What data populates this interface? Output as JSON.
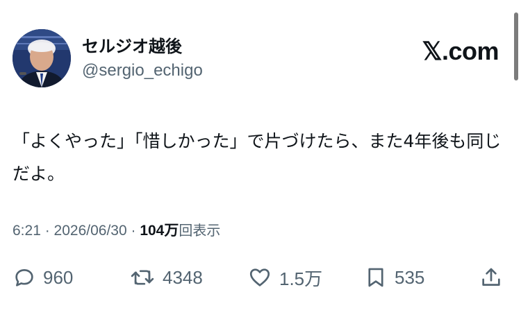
{
  "author": {
    "display_name": "セルジオ越後",
    "handle": "@sergio_echigo"
  },
  "brand": "𝕏.com",
  "tweet": {
    "text": "「よくやった」「惜しかった」で片づけたら、また4年後も同じだよ。"
  },
  "meta": {
    "time": "6:21",
    "separator1": " · ",
    "date": "2026/06/30",
    "separator2": " · ",
    "views": "104万",
    "views_label": "回表示"
  },
  "actions": {
    "replies": {
      "icon": "reply-icon",
      "count": "960"
    },
    "reposts": {
      "icon": "repost-icon",
      "count": "4348"
    },
    "likes": {
      "icon": "heart-icon",
      "count": "1.5万"
    },
    "bookmarks": {
      "icon": "bookmark-icon",
      "count": "535"
    },
    "share": {
      "icon": "share-icon"
    }
  },
  "colors": {
    "text_primary": "#0f1419",
    "text_secondary": "#536471",
    "background": "#ffffff"
  }
}
